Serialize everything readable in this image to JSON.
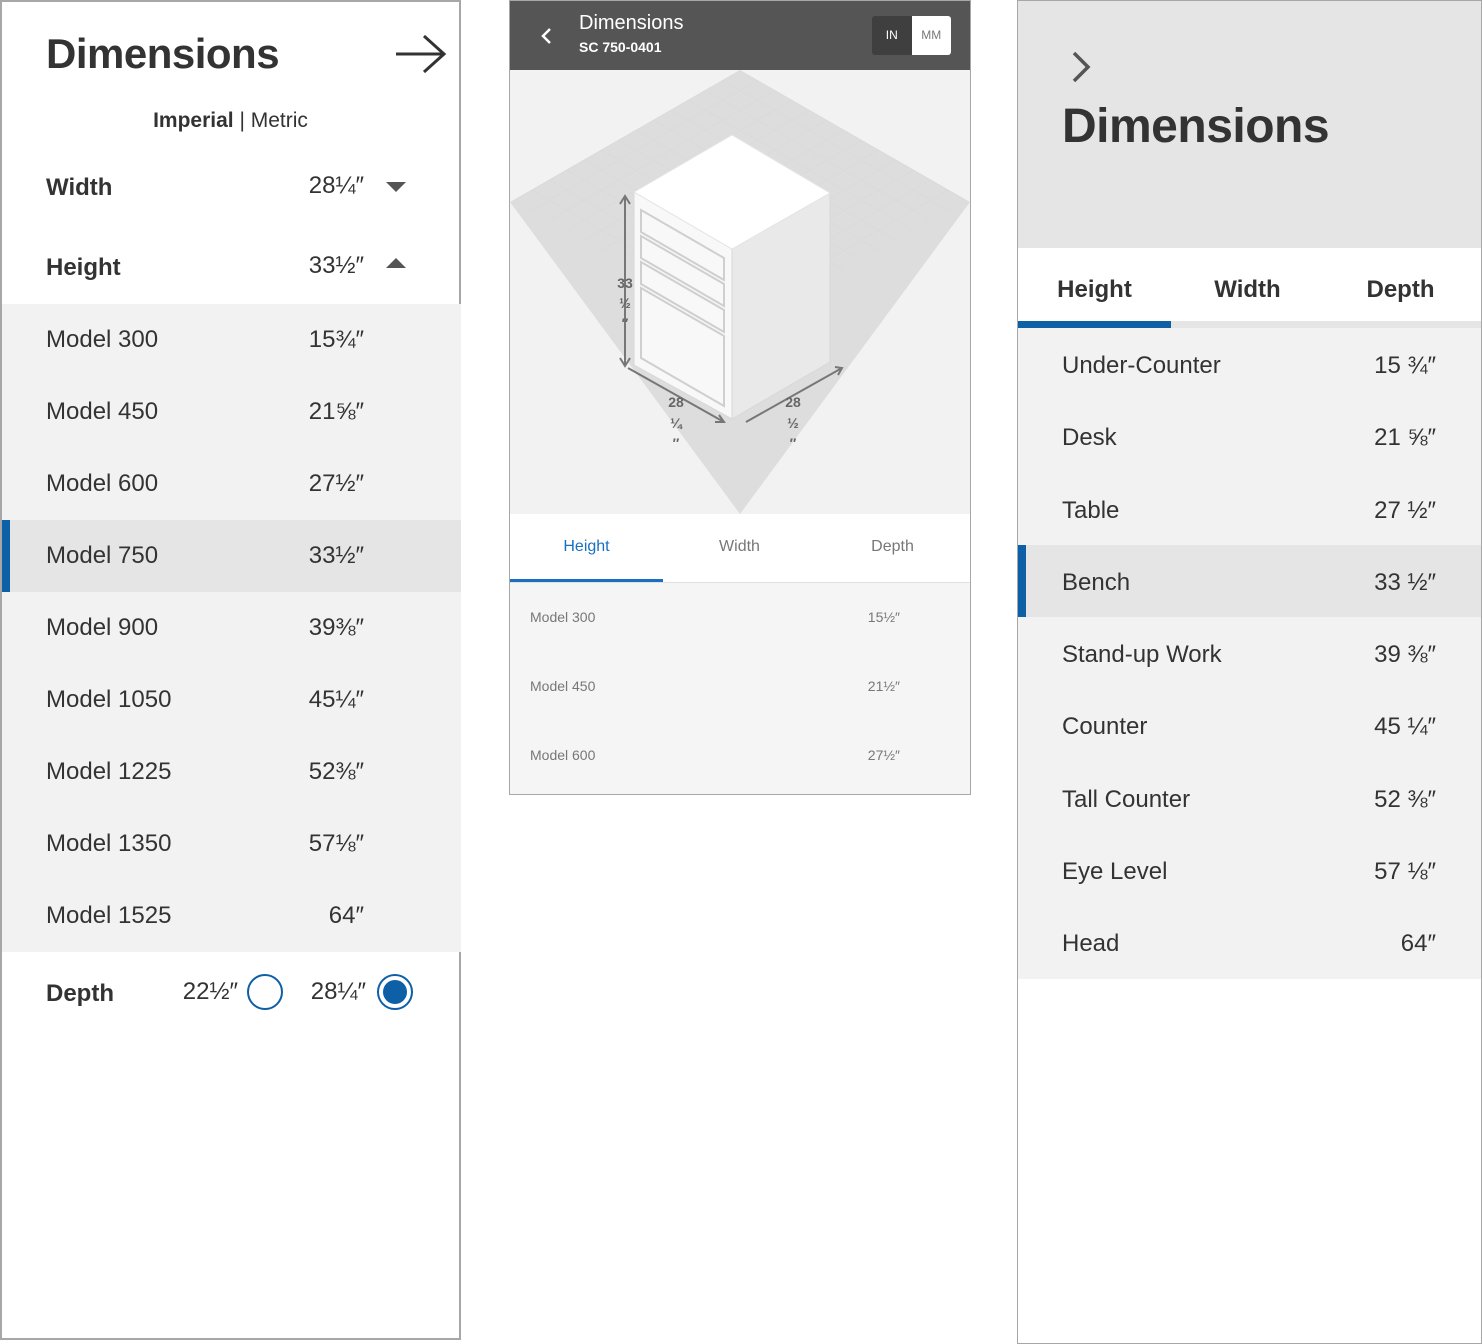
{
  "panel1": {
    "title": "Dimensions",
    "units_imperial": "Imperial",
    "units_separator": " | ",
    "units_metric": "Metric",
    "width": {
      "label": "Width",
      "value": "28¼″"
    },
    "height": {
      "label": "Height",
      "value": "33½″"
    },
    "models": [
      {
        "label": "Model 300",
        "value": "15¾″"
      },
      {
        "label": "Model 450",
        "value": "21⅝″"
      },
      {
        "label": "Model 600",
        "value": "27½″"
      },
      {
        "label": "Model 750",
        "value": "33½″"
      },
      {
        "label": "Model 900",
        "value": "39⅜″"
      },
      {
        "label": "Model 1050",
        "value": "45¼″"
      },
      {
        "label": "Model 1225",
        "value": "52⅜″"
      },
      {
        "label": "Model 1350",
        "value": "57⅛″"
      },
      {
        "label": "Model 1525",
        "value": "64″"
      }
    ],
    "depth": {
      "label": "Depth",
      "option1": "22½″",
      "option2": "28¼″"
    },
    "accent": "#0d5fa6"
  },
  "panel2": {
    "title": "Dimensions",
    "subtitle": "SC 750-0401",
    "toggle_in": "IN",
    "toggle_mm": "MM",
    "dims": {
      "height_num": "33",
      "height_frac": "½",
      "width_num": "28",
      "width_frac": "¼",
      "depth_num": "28",
      "depth_frac": "½",
      "mark": "″"
    },
    "tabs": [
      "Height",
      "Width",
      "Depth"
    ],
    "models": [
      {
        "label": "Model 300",
        "value": "15½″"
      },
      {
        "label": "Model 450",
        "value": "21½″"
      },
      {
        "label": "Model 600",
        "value": "27½″"
      }
    ],
    "accent": "#1a6fc0"
  },
  "panel3": {
    "title": "Dimensions",
    "tabs": [
      "Height",
      "Width",
      "Depth"
    ],
    "items": [
      {
        "label": "Under-Counter",
        "value": "15 ¾″"
      },
      {
        "label": "Desk",
        "value": "21 ⅝″"
      },
      {
        "label": "Table",
        "value": "27 ½″"
      },
      {
        "label": "Bench",
        "value": "33 ½″"
      },
      {
        "label": "Stand-up Work",
        "value": "39 ⅜″"
      },
      {
        "label": "Counter",
        "value": "45 ¼″"
      },
      {
        "label": "Tall Counter",
        "value": "52 ⅜″"
      },
      {
        "label": "Eye Level",
        "value": "57 ⅛″"
      },
      {
        "label": "Head",
        "value": "64″"
      }
    ]
  }
}
